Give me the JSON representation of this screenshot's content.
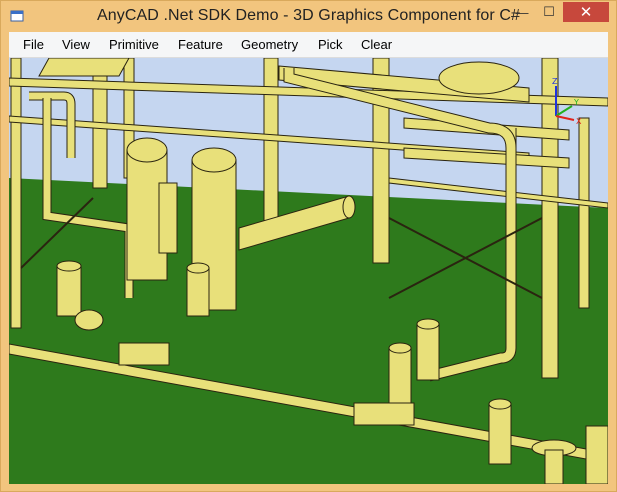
{
  "window": {
    "title": "AnyCAD .Net SDK Demo - 3D Graphics Component for C#",
    "buttons": {
      "minimize": "—",
      "maximize": "☐",
      "close": "✕"
    }
  },
  "menu": {
    "items": [
      "File",
      "View",
      "Primitive",
      "Feature",
      "Geometry",
      "Pick",
      "Clear"
    ]
  },
  "viewport": {
    "scene": "3D industrial piping model",
    "axis_labels": {
      "x": "X",
      "y": "Y",
      "z": "Z"
    },
    "colors": {
      "sky": "#c5d6f0",
      "floor": "#2e7a1c",
      "metal": "#e8e07a",
      "metal_shade": "#a89a35",
      "outline": "#2a2410",
      "axis_x": "#e0241c",
      "axis_y": "#22b020",
      "axis_z": "#2033e0"
    }
  }
}
